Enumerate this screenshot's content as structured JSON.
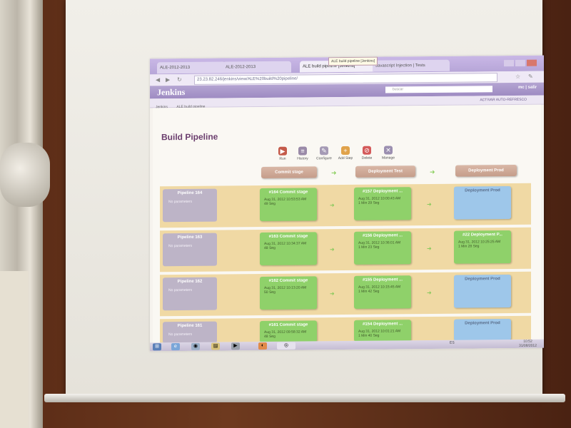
{
  "browser": {
    "tabs": [
      {
        "label": "ALE-2012-2013"
      },
      {
        "label": "ALE-2012-2013"
      },
      {
        "label": "ALE build pipeline [Jenkins]",
        "active": true
      },
      {
        "label": "Javascript Injection | Tests"
      }
    ],
    "tooltip": "ALE build pipeline [Jenkins]",
    "url": "23.23.82.246/jenkins/view/ALE%20build%20pipeline/"
  },
  "jenkins": {
    "logo": "Jenkins",
    "search_placeholder": "buscar",
    "user": "mc | salir",
    "breadcrumb": [
      "Jenkins",
      "ALE build pipeline"
    ],
    "auto_refresh": "ACTIVAR AUTO-REFRESCO"
  },
  "page": {
    "title": "Build Pipeline",
    "toolbar": [
      {
        "label": "Run",
        "icon": "run-icon"
      },
      {
        "label": "History",
        "icon": "history-icon"
      },
      {
        "label": "Configure",
        "icon": "configure-icon"
      },
      {
        "label": "Add Step",
        "icon": "add-step-icon"
      },
      {
        "label": "Delete",
        "icon": "delete-icon"
      },
      {
        "label": "Manage",
        "icon": "manage-icon"
      }
    ],
    "stages": [
      "Commit stage",
      "Deployment Test",
      "Deployment Prod"
    ]
  },
  "pipelines": [
    {
      "name": "Pipeline 164",
      "params": "No parameters",
      "commit": {
        "title": "#164 Commit stage",
        "date": "Aug 31, 2012 10:53:53 AM",
        "dur": "49 Seg"
      },
      "test": {
        "title": "#157 Deployment ...",
        "date": "Aug 31, 2012 10:00:43 AM",
        "dur": "1 Min 29 Seg"
      },
      "prod": {
        "title": "Deployment Prod",
        "status": "blue"
      }
    },
    {
      "name": "Pipeline 163",
      "params": "No parameters",
      "commit": {
        "title": "#163 Commit stage",
        "date": "Aug 31, 2012 10:34:37 AM",
        "dur": "48 Seg"
      },
      "test": {
        "title": "#156 Deployment ...",
        "date": "Aug 31, 2012 10:36:01 AM",
        "dur": "1 Min 23 Seg"
      },
      "prod": {
        "title": "#22 Deployment P...",
        "date": "Aug 31, 2012 10:25:25 AM",
        "dur": "1 Min 28 Seg",
        "status": "green"
      }
    },
    {
      "name": "Pipeline 162",
      "params": "No parameters",
      "commit": {
        "title": "#162 Commit stage",
        "date": "Aug 31, 2012 10:13:20 AM",
        "dur": "50 Seg"
      },
      "test": {
        "title": "#155 Deployment ...",
        "date": "Aug 31, 2012 10:15:45 AM",
        "dur": "1 Min 42 Seg"
      },
      "prod": {
        "title": "Deployment Prod",
        "status": "blue"
      }
    },
    {
      "name": "Pipeline 161",
      "params": "No parameters",
      "commit": {
        "title": "#161 Commit stage",
        "date": "Aug 31, 2012 09:58:32 AM",
        "dur": "48 Seg"
      },
      "test": {
        "title": "#154 Deployment ...",
        "date": "Aug 31, 2012 10:01:21 AM",
        "dur": "1 Min 40 Seg"
      },
      "prod": {
        "title": "Deployment Prod",
        "status": "blue"
      }
    }
  ],
  "taskbar": {
    "clock_time": "10:52",
    "clock_date": "31/08/2012",
    "lang": "ES"
  },
  "colors": {
    "success": "#8fd16a",
    "not_built": "#9ec7ea",
    "row_bg": "#f0d9a4",
    "title": "#6b3e6e"
  }
}
